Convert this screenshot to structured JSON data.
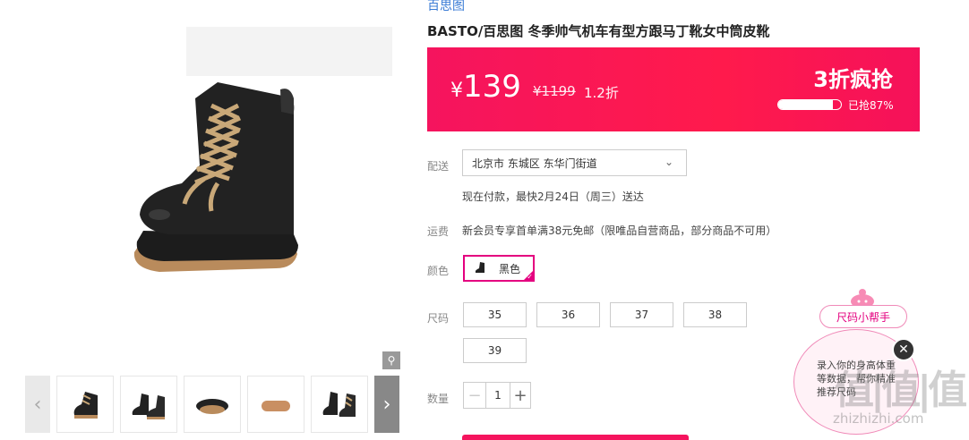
{
  "gallery": {
    "zoom_icon": "magnifier-icon",
    "prev_icon": "chevron-left-icon",
    "next_icon": "chevron-right-icon",
    "thumbnails": [
      "boot-side",
      "boot-pair",
      "boot-sole-pair",
      "boot-sole",
      "boot-pair-laces"
    ]
  },
  "product": {
    "brand_link": "百思图",
    "title": "BASTO/百思图 冬季帅气机车有型方跟马丁靴女中筒皮靴"
  },
  "price": {
    "currency": "¥",
    "current": "139",
    "original": "¥1199",
    "discount": "1.2折",
    "flash_title": "3折疯抢",
    "sold_percent": 87,
    "sold_text": "已抢87%",
    "colors": {
      "start": "#f5145e",
      "end": "#ff1a4c"
    }
  },
  "delivery": {
    "label": "配送",
    "location": "北京市 东城区 东华门街道",
    "eta": "现在付款，最快2月24日（周三）送达"
  },
  "shipping": {
    "label": "运费",
    "text": "新会员专享首单满38元免邮（限唯品自营商品，部分商品不可用）"
  },
  "color": {
    "label": "颜色",
    "selected": "黑色",
    "accent": "#e4007f"
  },
  "size": {
    "label": "尺码",
    "options": [
      "35",
      "36",
      "37",
      "38",
      "39"
    ]
  },
  "quantity": {
    "label": "数量",
    "value": "1",
    "minus": "−",
    "plus": "+"
  },
  "helper": {
    "tag": "尺码小帮手",
    "text": "录入你的身高体重等数据，帮你精准推荐尺码",
    "close": "✕"
  },
  "watermark": {
    "logo": "值|值|值",
    "url": "zhizhizhi.com"
  }
}
